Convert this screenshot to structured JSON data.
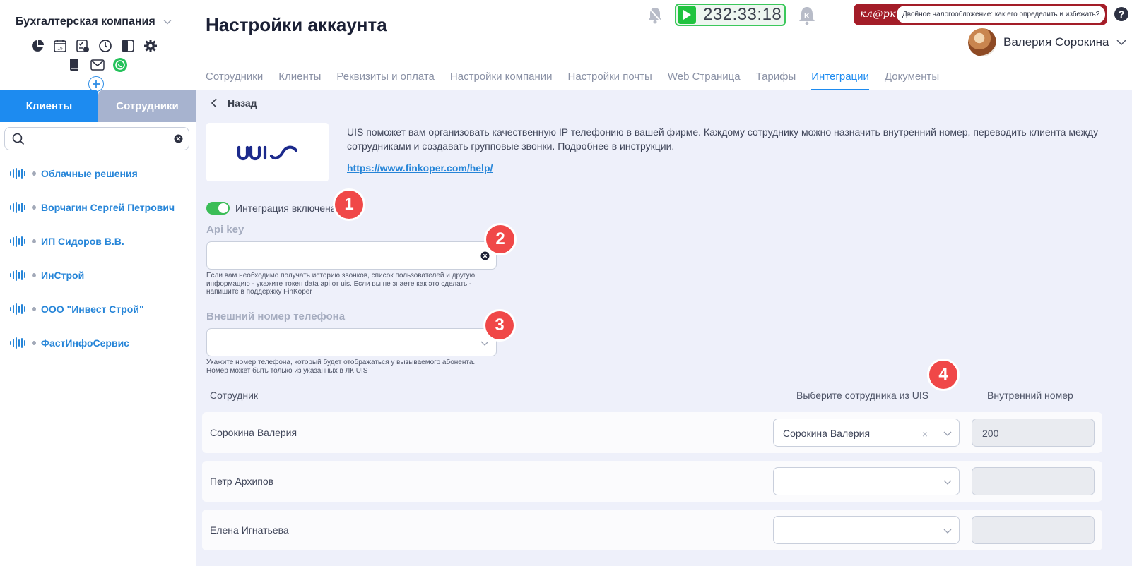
{
  "sidebar": {
    "company": "Бухгалтерская компания",
    "tabs": {
      "clients": "Клиенты",
      "employees": "Сотрудники"
    },
    "search": {
      "value": "",
      "placeholder": ""
    },
    "clients": [
      {
        "name": "Облачные решения"
      },
      {
        "name": "Ворчагин Сергей Петрович"
      },
      {
        "name": "ИП Сидоров В.В."
      },
      {
        "name": "ИнСтрой"
      },
      {
        "name": "ООО \"Инвест Строй\""
      },
      {
        "name": "ФастИнфоСервис"
      }
    ],
    "toolbar_icons": [
      "pie-chart-icon",
      "calendar-icon",
      "tasks-icon",
      "clock-icon",
      "layout-icon",
      "gear-icon",
      "book-icon",
      "mail-icon",
      "whatsapp-icon"
    ]
  },
  "header": {
    "title": "Настройки аккаунта",
    "timer": "232:33:18",
    "news_logo": "кл@рк",
    "news_text": "Двойное налогообложение: как его определить и избежать?",
    "help": "?",
    "user_name": "Валерия Сорокина"
  },
  "nav_tabs": [
    {
      "label": "Сотрудники"
    },
    {
      "label": "Клиенты"
    },
    {
      "label": "Реквизиты и оплата"
    },
    {
      "label": "Настройки компании"
    },
    {
      "label": "Настройки почты"
    },
    {
      "label": "Web Страница"
    },
    {
      "label": "Тарифы"
    },
    {
      "label": "Интеграции",
      "active": true
    },
    {
      "label": "Документы"
    }
  ],
  "content": {
    "back": "Назад",
    "description": "UIS поможет вам организовать качественную IP телефонию в вашей фирме. Каждому сотруднику можно назначить внутренний номер, переводить клиента между сотрудниками и создавать групповые звонки. Подробнее в инструкции.",
    "link": "https://www.finkoper.com/help/",
    "toggle_label": "Интеграция включена",
    "toggle_on": true,
    "api_key": {
      "label": "Api key",
      "value": "",
      "hint": "Если вам необходимо получать историю звонков, список пользователей и другую информацию - укажите токен data api от uis. Если вы не знаете как это сделать - напишите в поддержку FinKoper"
    },
    "phone": {
      "label": "Внешний номер телефона",
      "value": "",
      "hint": "Укажите номер телефона, который будет отображаться у вызываемого абонента. Номер может быть только из указанных в ЛК UIS"
    },
    "table": {
      "headers": {
        "employee": "Сотрудник",
        "uis_employee": "Выберите сотрудника из UIS",
        "ext": "Внутренний номер"
      },
      "rows": [
        {
          "name": "Сорокина Валерия",
          "uis": "Сорокина Валерия",
          "clear": "×",
          "ext": "200"
        },
        {
          "name": "Петр Архипов",
          "uis": "",
          "clear": "",
          "ext": ""
        },
        {
          "name": "Елена Игнатьева",
          "uis": "",
          "clear": "",
          "ext": ""
        }
      ]
    },
    "badges": [
      "1",
      "2",
      "3",
      "4"
    ]
  },
  "colors": {
    "accent": "#1d8bf0",
    "timer_green": "#20c33f",
    "badge_red": "#f04848",
    "news_red": "#a31d28"
  }
}
